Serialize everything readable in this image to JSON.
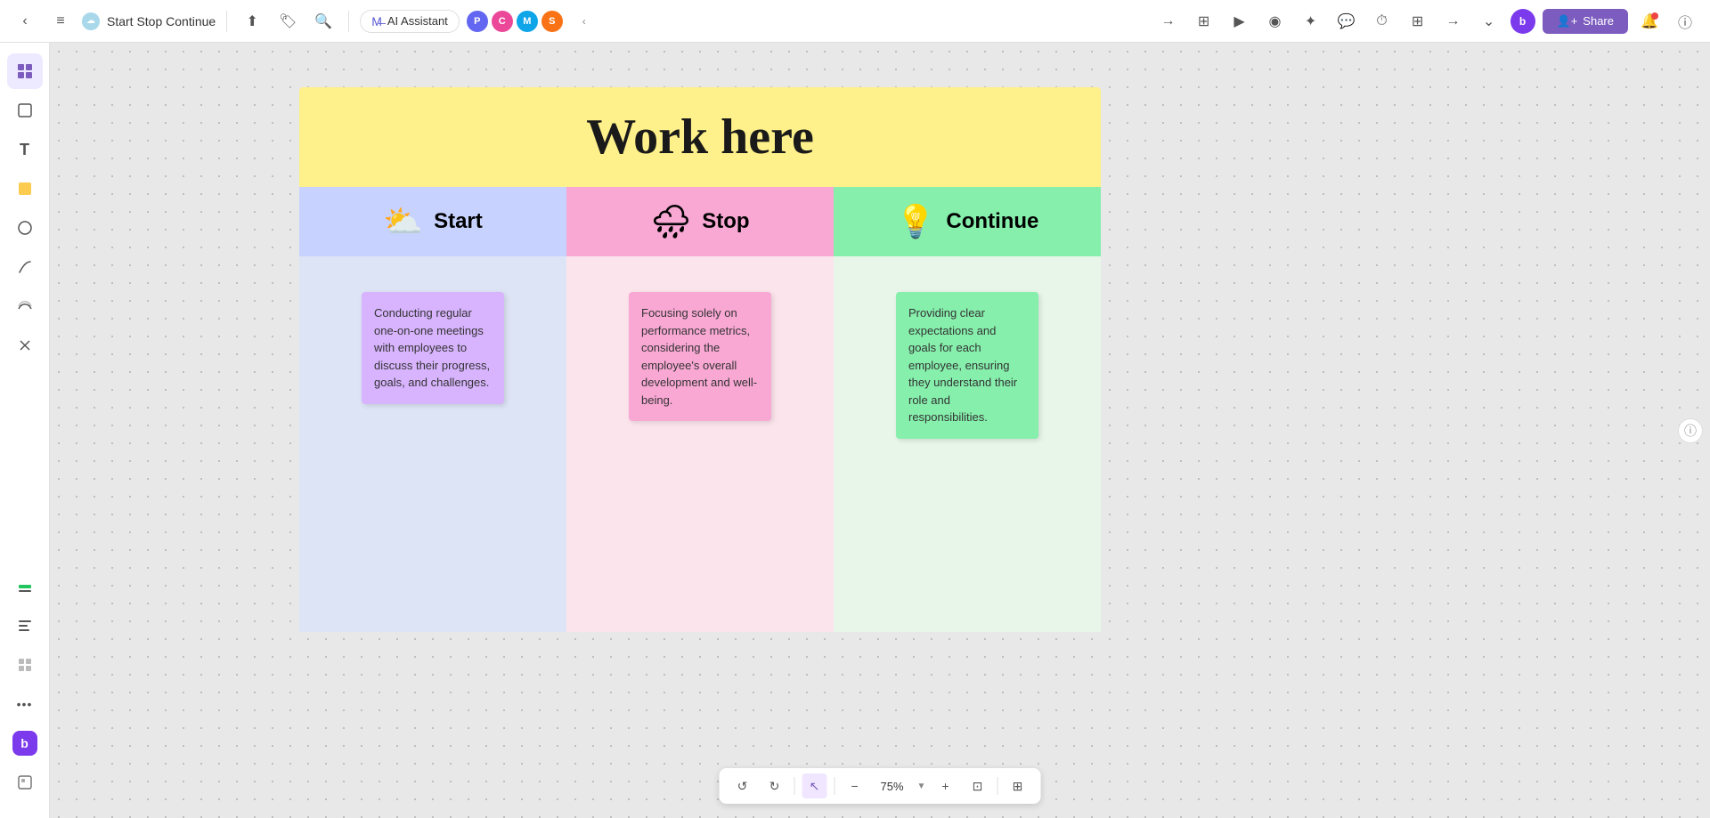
{
  "app": {
    "title": "Start Stop Continue",
    "icon": "☁️"
  },
  "toolbar": {
    "back_label": "‹",
    "menu_label": "≡",
    "upload_label": "⬆",
    "tag_label": "🏷",
    "search_label": "🔍",
    "ai_label": "AI Assistant",
    "more_label": "‹",
    "share_label": "Share",
    "notification_label": "🔔",
    "info_label": "ⓘ",
    "expand_label": "⛶",
    "play_label": "▶",
    "present_label": "◉",
    "comment_label": "💬",
    "timer_label": "⏱",
    "more2_label": "⋯",
    "grid_label": "⊞",
    "arrow_label": "→",
    "chevron_label": "⌄"
  },
  "sidebar": {
    "tools": [
      {
        "id": "home",
        "icon": "⬡",
        "active": true
      },
      {
        "id": "frame",
        "icon": "⬜",
        "active": false
      },
      {
        "id": "text",
        "icon": "T",
        "active": false
      },
      {
        "id": "sticky",
        "icon": "📝",
        "active": false
      },
      {
        "id": "shape",
        "icon": "◎",
        "active": false
      },
      {
        "id": "pen",
        "icon": "✏",
        "active": false
      },
      {
        "id": "brush",
        "icon": "≋",
        "active": false
      },
      {
        "id": "scissors",
        "icon": "✂",
        "active": false
      },
      {
        "id": "highlight",
        "icon": "▬",
        "active": false
      },
      {
        "id": "more",
        "icon": "•••",
        "active": false
      },
      {
        "id": "brand",
        "icon": "b",
        "active": false
      }
    ]
  },
  "board": {
    "title": "Work here",
    "title_bg": "#fef08a",
    "columns": [
      {
        "id": "start",
        "label": "Start",
        "emoji": "⛅",
        "header_bg": "#c7d2fe",
        "body_bg": "#dde4f5",
        "note_bg": "#d8b4fe",
        "note_text": "Conducting regular one-on-one meetings with employees to discuss their progress, goals, and challenges."
      },
      {
        "id": "stop",
        "label": "Stop",
        "emoji": "🌧",
        "header_bg": "#f9a8d4",
        "body_bg": "#fce4ec",
        "note_bg": "#f9a8d4",
        "note_text": "Focusing solely on performance metrics, considering the employee's overall development and well-being."
      },
      {
        "id": "continue",
        "label": "Continue",
        "emoji": "💡",
        "header_bg": "#86efac",
        "body_bg": "#e8f5e9",
        "note_bg": "#86efac",
        "note_text": "Providing clear expectations and goals for each employee, ensuring they understand their role and responsibilities."
      }
    ]
  },
  "bottom_bar": {
    "undo_label": "↺",
    "redo_label": "↻",
    "cursor_label": "↖",
    "zoom_out_label": "−",
    "zoom_level": "75%",
    "zoom_in_label": "+",
    "fit_label": "⊡",
    "minimap_label": "⊞"
  },
  "icon_colors": {
    "purple_circle": "#7c5cbf",
    "p_badge": "#6366f1",
    "c_badge": "#ec4899",
    "ms_badge": "#0ea5e9",
    "sf_badge": "#f97316",
    "avatar_bg": "#7c3aed"
  }
}
